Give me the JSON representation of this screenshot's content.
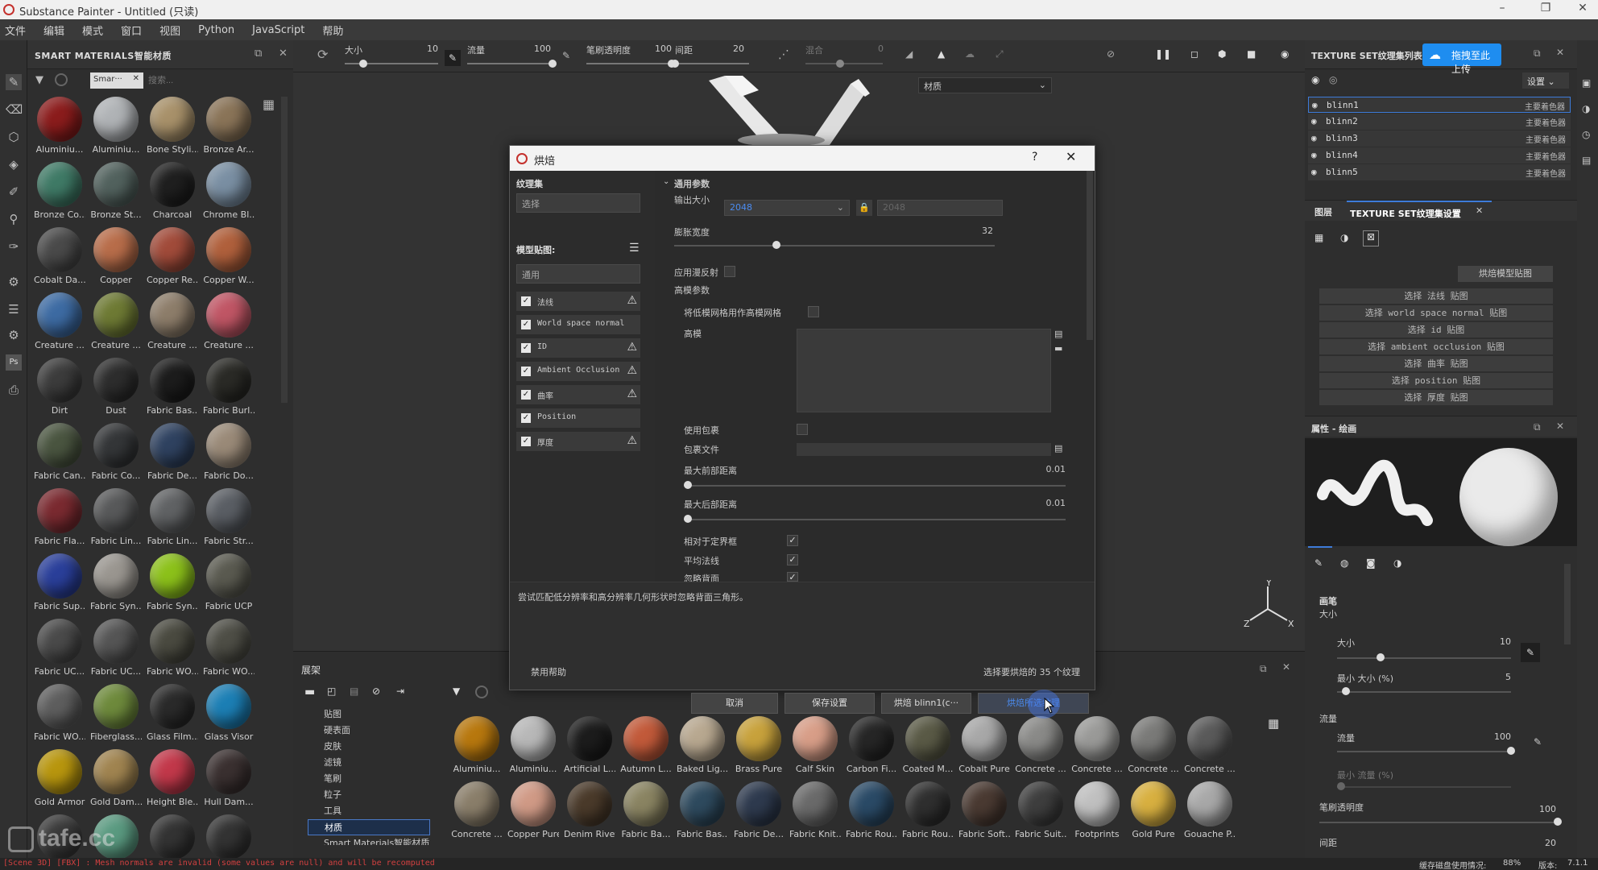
{
  "window": {
    "title": "Substance Painter - Untitled (只读)",
    "min": "–",
    "max": "❐",
    "close": "✕"
  },
  "menu": [
    "文件",
    "编辑",
    "模式",
    "窗口",
    "视图",
    "Python",
    "JavaScript",
    "帮助"
  ],
  "smart_materials": {
    "title": "SMART MATERIALS智能材质",
    "filter_chip": "Smar···",
    "search_placeholder": "搜索...",
    "items": [
      {
        "label": "Aluminiu...",
        "color": "#8b1c1c"
      },
      {
        "label": "Aluminiu...",
        "color": "#b0b3b6"
      },
      {
        "label": "Bone Styli...",
        "color": "#a8916a"
      },
      {
        "label": "Bronze Ar...",
        "color": "#8a7458"
      },
      {
        "label": "Bronze Co...",
        "color": "#3f7a66"
      },
      {
        "label": "Bronze St...",
        "color": "#52625e"
      },
      {
        "label": "Charcoal",
        "color": "#1f1f1f"
      },
      {
        "label": "Chrome Bl...",
        "color": "#7a8fa3"
      },
      {
        "label": "Cobalt Da...",
        "color": "#4a4a4a"
      },
      {
        "label": "Copper",
        "color": "#b86d4a"
      },
      {
        "label": "Copper Re...",
        "color": "#a14b3a"
      },
      {
        "label": "Copper W...",
        "color": "#b0603c"
      },
      {
        "label": "Creature ...",
        "color": "#3d6ba3"
      },
      {
        "label": "Creature ...",
        "color": "#6e7a34"
      },
      {
        "label": "Creature ...",
        "color": "#8d7d6a"
      },
      {
        "label": "Creature ...",
        "color": "#c05665"
      },
      {
        "label": "Dirt",
        "color": "#3c3c3c"
      },
      {
        "label": "Dust",
        "color": "#2d2d2d"
      },
      {
        "label": "Fabric Bas...",
        "color": "#1c1c1c"
      },
      {
        "label": "Fabric Burl...",
        "color": "#2a2a26"
      },
      {
        "label": "Fabric Can...",
        "color": "#4a5540"
      },
      {
        "label": "Fabric Co...",
        "color": "#343638"
      },
      {
        "label": "Fabric De...",
        "color": "#2f4260"
      },
      {
        "label": "Fabric Do...",
        "color": "#9a8a78"
      },
      {
        "label": "Fabric Fla...",
        "color": "#7a2a30"
      },
      {
        "label": "Fabric Lin...",
        "color": "#58595a"
      },
      {
        "label": "Fabric Lin...",
        "color": "#606264"
      },
      {
        "label": "Fabric Str...",
        "color": "#5a5e64"
      },
      {
        "label": "Fabric Sup...",
        "color": "#2a3f9a"
      },
      {
        "label": "Fabric Syn...",
        "color": "#9a9690"
      },
      {
        "label": "Fabric Syn...",
        "color": "#8cc11a"
      },
      {
        "label": "Fabric UCP",
        "color": "#5a5a50"
      },
      {
        "label": "Fabric UC...",
        "color": "#4a4a4a"
      },
      {
        "label": "Fabric UC...",
        "color": "#555"
      },
      {
        "label": "Fabric WO...",
        "color": "#4a4a40"
      },
      {
        "label": "Fabric WO...",
        "color": "#4e4e46"
      },
      {
        "label": "Fabric WO...",
        "color": "#5e5e5e"
      },
      {
        "label": "Fiberglass...",
        "color": "#6e8a3c"
      },
      {
        "label": "Glass Film...",
        "color": "#2a2a2a"
      },
      {
        "label": "Glass Visor",
        "color": "#1c7fb5"
      },
      {
        "label": "Gold Armor",
        "color": "#b8960e"
      },
      {
        "label": "Gold Dam...",
        "color": "#a08450"
      },
      {
        "label": "Height Ble...",
        "color": "#c2384a"
      },
      {
        "label": "Hull Dam...",
        "color": "#3a3030"
      },
      {
        "label": "",
        "color": "#3a3a3a"
      },
      {
        "label": "",
        "color": "#5a9a80"
      },
      {
        "label": "",
        "color": "#333"
      },
      {
        "label": "",
        "color": "#333"
      }
    ]
  },
  "topbar": {
    "size_label": "大小",
    "size_value": "10",
    "size_frac": 0.2,
    "flow_label": "流量",
    "flow_value": "100",
    "flow_frac": 1.0,
    "opacity_label": "笔刷透明度",
    "opacity_value": "100",
    "opacity_frac": 1.0,
    "spacing_label": "间距",
    "spacing_value": "20",
    "spacing_frac": 0.0,
    "mix_label": "混合",
    "mix_value": "0",
    "material_select": "材质"
  },
  "dialog": {
    "title": "烘焙",
    "help": "?",
    "close": "✕",
    "texset_label": "纹理集",
    "texset_select": "选择",
    "model_maps_label": "模型贴图:",
    "common_label": "通用",
    "maps": [
      {
        "label": "法线",
        "checked": true,
        "warn": true
      },
      {
        "label": "World space normal",
        "checked": true,
        "warn": false
      },
      {
        "label": "ID",
        "checked": true,
        "warn": true
      },
      {
        "label": "Ambient Occlusion",
        "checked": true,
        "warn": true
      },
      {
        "label": "曲率",
        "checked": true,
        "warn": true
      },
      {
        "label": "Position",
        "checked": true,
        "warn": false
      },
      {
        "label": "厚度",
        "checked": true,
        "warn": true
      }
    ],
    "section_common": "通用参数",
    "output_size_label": "输出大小",
    "output_size_value": "2048",
    "output_size_value2": "2048",
    "dilation_label": "膨胀宽度",
    "dilation_value": "32",
    "dilation_frac": 0.32,
    "apply_diffuse_label": "应用漫反射",
    "hp_params_label": "高模参数",
    "use_lowpoly_label": "将低模网格用作高模网格",
    "hp_label": "高模",
    "use_cage_label": "使用包裹",
    "cage_file_label": "包裹文件",
    "max_front_label": "最大前部距离",
    "max_front_value": "0.01",
    "max_front_frac": 0.01,
    "max_rear_label": "最大后部距离",
    "max_rear_value": "0.01",
    "max_rear_frac": 0.01,
    "relative_bbox_label": "相对于定界框",
    "relative_bbox_checked": true,
    "average_normals_label": "平均法线",
    "average_normals_checked": true,
    "ignore_backface_label": "忽略背面",
    "ignore_backface_checked": true,
    "hint_text": "尝试匹配低分辨率和高分辨率几何形状时忽略背面三角形。",
    "disable_help": "禁用帮助",
    "selected_count": "选择要烘焙的 35 个纹理",
    "cancel": "取消",
    "save": "保存设置",
    "bake_one": "烘焙 blinn1(c···",
    "bake_selected": "烘焙所选纹理"
  },
  "shelf": {
    "title": "展架",
    "categories": [
      "贴图",
      "硬表面",
      "皮肤",
      "滤镜",
      "笔刷",
      "粒子",
      "工具",
      "材质",
      "Smart Materials智能材质"
    ],
    "selected_category": "材质",
    "materials": [
      {
        "label": "Aluminiu...",
        "color": "#b8780e"
      },
      {
        "label": "Aluminiu...",
        "color": "#b8b8b8"
      },
      {
        "label": "Artificial L...",
        "color": "#1c1c1c"
      },
      {
        "label": "Autumn L...",
        "color": "#c25a3a"
      },
      {
        "label": "Baked Lig...",
        "color": "#b8a890"
      },
      {
        "label": "Brass Pure",
        "color": "#c8a23c"
      },
      {
        "label": "Calf Skin",
        "color": "#d89e88"
      },
      {
        "label": "Carbon Fi...",
        "color": "#262626"
      },
      {
        "label": "Coated M...",
        "color": "#5a5a46"
      },
      {
        "label": "Cobalt Pure",
        "color": "#a8a8a8"
      },
      {
        "label": "Concrete ...",
        "color": "#8a8a88"
      },
      {
        "label": "Concrete ...",
        "color": "#9a9a98"
      },
      {
        "label": "Concrete ...",
        "color": "#7a7a78"
      },
      {
        "label": "Concrete ...",
        "color": "#5a5a5a"
      },
      {
        "label": "Concrete ...",
        "color": "#8a7e6a"
      },
      {
        "label": "Copper Pure",
        "color": "#d09a86"
      },
      {
        "label": "Denim Rivet",
        "color": "#4a3a2a"
      },
      {
        "label": "Fabric Ba...",
        "color": "#8a8462"
      },
      {
        "label": "Fabric Bas...",
        "color": "#2e4a5e"
      },
      {
        "label": "Fabric De...",
        "color": "#2e3a4e"
      },
      {
        "label": "Fabric Knit...",
        "color": "#6a6a6a"
      },
      {
        "label": "Fabric Rou...",
        "color": "#2a4a66"
      },
      {
        "label": "Fabric Rou...",
        "color": "#2f2f2f"
      },
      {
        "label": "Fabric Soft...",
        "color": "#4a3a32"
      },
      {
        "label": "Fabric Suit...",
        "color": "#3e3e3e"
      },
      {
        "label": "Footprints",
        "color": "#c0c0c0"
      },
      {
        "label": "Gold Pure",
        "color": "#d8b040"
      },
      {
        "label": "Gouache P...",
        "color": "#a8a8a8"
      }
    ]
  },
  "textureset_list": {
    "title": "TEXTURE SET纹理集列表",
    "settings": "设置",
    "upload_btn": "拖拽至此上传",
    "rows": [
      {
        "name": "blinn1",
        "shader": "主要着色器"
      },
      {
        "name": "blinn2",
        "shader": "主要着色器"
      },
      {
        "name": "blinn3",
        "shader": "主要着色器"
      },
      {
        "name": "blinn4",
        "shader": "主要着色器"
      },
      {
        "name": "blinn5",
        "shader": "主要着色器"
      }
    ]
  },
  "textureset_settings": {
    "tab_layers": "图层",
    "tab_settings": "TEXTURE SET纹理集设置",
    "bake_btn": "烘焙模型贴图",
    "select_btns": [
      "选择 法线 贴图",
      "选择 world space normal 贴图",
      "选择 id 贴图",
      "选择 ambient occlusion 贴图",
      "选择 曲率 贴图",
      "选择 position 贴图",
      "选择 厚度 贴图"
    ]
  },
  "properties": {
    "title": "属性 - 绘画",
    "brush_label": "画笔",
    "size_label": "大小",
    "size_sub": "大小",
    "size_value": "10",
    "size_frac": 0.25,
    "minsize_label": "最小 大小 (%)",
    "minsize_value": "5",
    "minsize_frac": 0.05,
    "flow_label": "流量",
    "flow_sub": "流量",
    "flow_value": "100",
    "flow_frac": 1.0,
    "minflow_label": "最小 流量 (%)",
    "opacity_label": "笔刷透明度",
    "opacity_value": "100",
    "opacity_frac": 1.0,
    "spacing_label": "间距",
    "spacing_value": "20"
  },
  "status": {
    "message": "[Scene 3D] [FBX] : Mesh normals are invalid (some values are null) and will be recomputed",
    "disk_label": "缓存磁盘使用情况:",
    "disk_value": "88%",
    "version_label": "版本:",
    "version_value": "7.1.1",
    "watermark": "tafe.cc"
  },
  "colors": {
    "accent": "#3d7bd9",
    "warn": "#e04040"
  }
}
